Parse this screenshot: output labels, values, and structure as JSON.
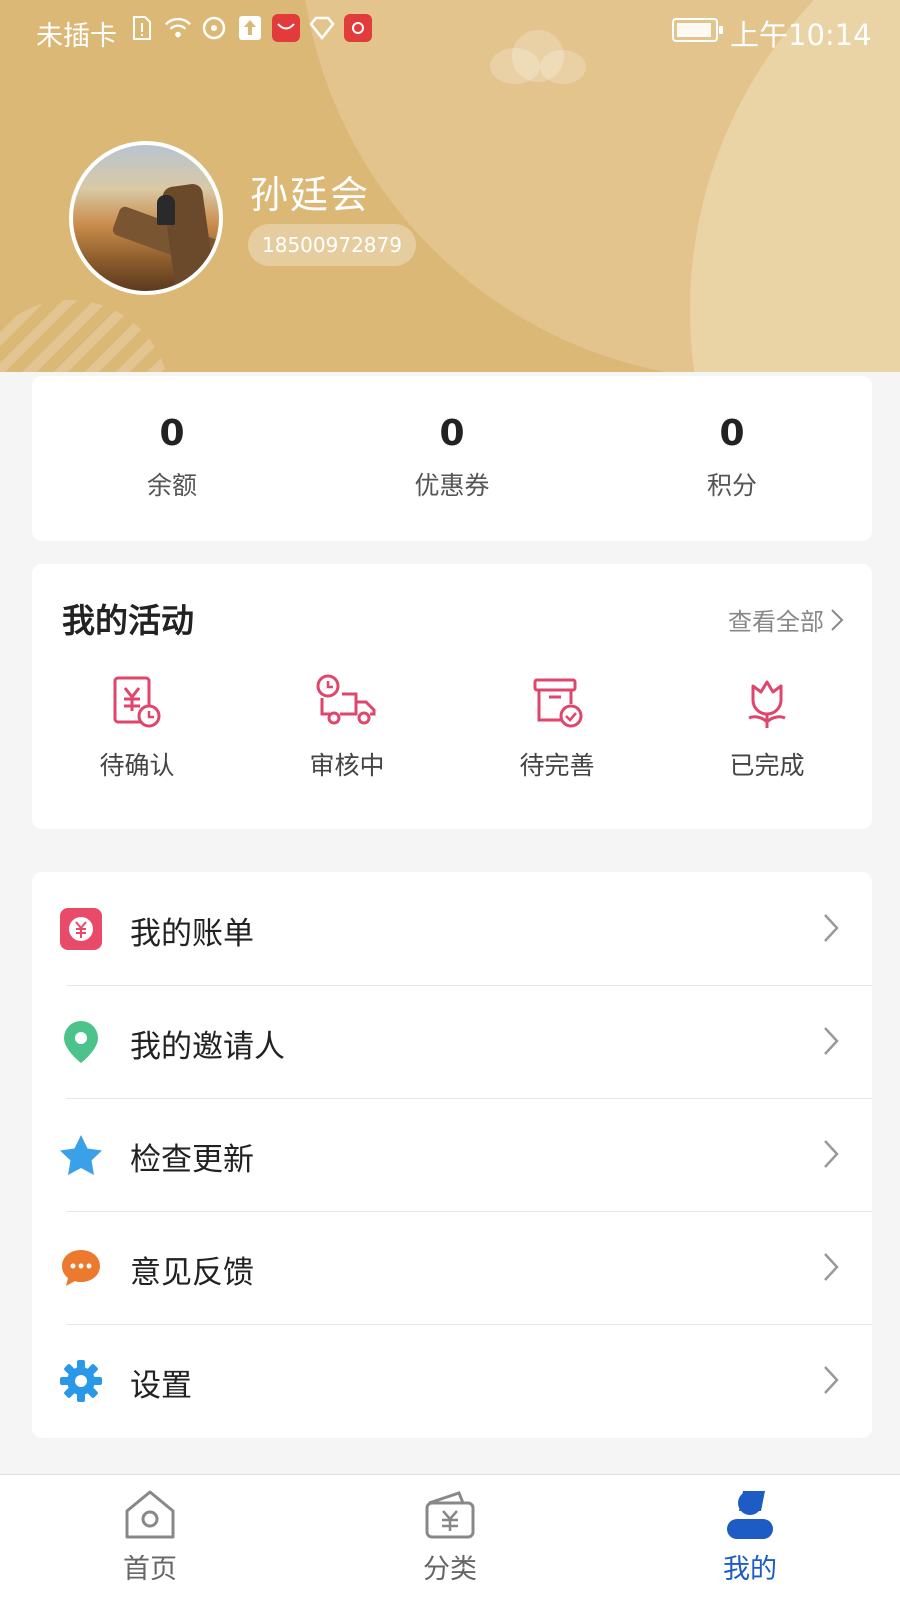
{
  "status_bar": {
    "carrier": "未插卡",
    "time": "上午10:14",
    "icons": [
      "sim-alert-icon",
      "wifi-icon",
      "hotspot-icon",
      "upload-icon",
      "huawei-app-icon",
      "diamond-icon",
      "huawei-store-icon",
      "battery-icon"
    ]
  },
  "profile": {
    "name": "孙廷会",
    "phone": "18500972879"
  },
  "stats": [
    {
      "value": "0",
      "label": "余额"
    },
    {
      "value": "0",
      "label": "优惠券"
    },
    {
      "value": "0",
      "label": "积分"
    }
  ],
  "activity": {
    "title": "我的活动",
    "view_all": "查看全部",
    "items": [
      {
        "label": "待确认",
        "icon": "pending-confirm-icon"
      },
      {
        "label": "审核中",
        "icon": "delivery-truck-icon"
      },
      {
        "label": "待完善",
        "icon": "to-complete-icon"
      },
      {
        "label": "已完成",
        "icon": "flower-icon"
      }
    ]
  },
  "menu": [
    {
      "label": "我的账单",
      "icon": "bill-icon"
    },
    {
      "label": "我的邀请人",
      "icon": "location-pin-icon"
    },
    {
      "label": "检查更新",
      "icon": "star-icon"
    },
    {
      "label": "意见反馈",
      "icon": "chat-bubble-icon"
    },
    {
      "label": "设置",
      "icon": "gear-icon"
    }
  ],
  "tabbar": [
    {
      "label": "首页",
      "icon": "home-icon"
    },
    {
      "label": "分类",
      "icon": "wallet-icon"
    },
    {
      "label": "我的",
      "icon": "user-icon",
      "active": true
    }
  ],
  "colors": {
    "header": "#dcb877",
    "activity_icon": "#e0456b",
    "active_tab": "#1c5cc4",
    "bill_icon": "#ea4a6a",
    "pin_icon": "#4cc38a",
    "star_icon": "#3aa0e8",
    "chat_icon": "#ec7a2e",
    "gear_icon": "#2a98e8"
  }
}
